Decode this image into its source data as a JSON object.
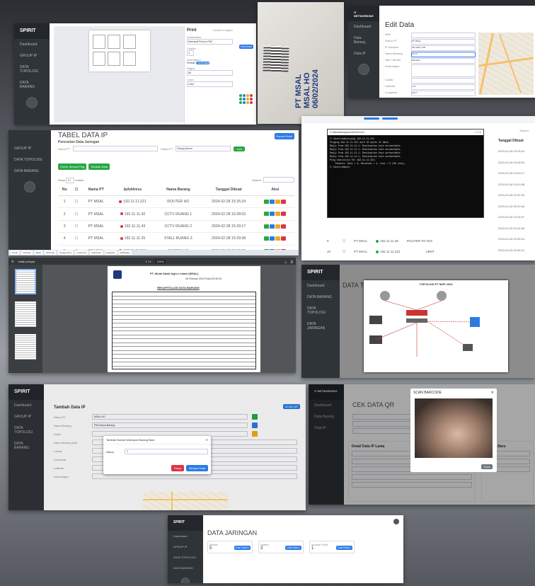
{
  "panel_print": {
    "title": "Print",
    "sheets": "1 sheet of paper",
    "destination_label": "Destination",
    "destination_value": "Microsoft Print to PDF",
    "copies_label": "Copies",
    "copies_value": "1",
    "layout_label": "Orientation",
    "options": [
      "Portrait",
      "Landscape"
    ],
    "pages_label": "Pages",
    "pages_value": "All",
    "color_label": "Color",
    "color_value": "Color",
    "sidebar_item": "Dashboard",
    "right_btn": "Download"
  },
  "panel_label": {
    "line1": "PT MSAL",
    "line2": "MSAL HO",
    "line3": "06/02/2024"
  },
  "panel_edit": {
    "brand": "IT NETWORKING",
    "title": "Edit Data",
    "labels": [
      "NPK",
      "Nama PT",
      "IP Address",
      "Nama Barang",
      "Tipe / Model",
      "Keterangan",
      "Lokasi",
      "Latitude",
      "Longitude"
    ],
    "values": [
      "",
      "PT MSAL",
      "192.168.1.100",
      "CCTV",
      "Hikvision",
      "",
      "",
      "-2.9",
      "104.7"
    ]
  },
  "panel_table": {
    "heading": "TABEL DATA IP",
    "subheading": "Pencarian Data Jaringan",
    "filter_label": "Nama PT",
    "filter2_label": "Status PT",
    "filter2_value": "Ruang Server",
    "btn_cari": "Cari",
    "btn_export": "Export Excel",
    "btn_check": "Check Semua Ping",
    "btn_add": "Tambah Data",
    "show_label": "Show",
    "show_value": "10",
    "entries_label": "entries",
    "search_label": "Search:",
    "sidebar": [
      "GROUP IP",
      "DATA TOPOLOGI",
      "DATA BARANG"
    ],
    "headers": [
      "No",
      "Nama PT",
      "IpAddress",
      "Nama Barang",
      "Tanggal Dibuat",
      "Aksi"
    ],
    "rows": [
      {
        "no": "1",
        "pt": "PT MSAL",
        "ip": "192.11.11.221",
        "barang": "ROUTER HO",
        "tgl": "2024-02-28 15:25:24"
      },
      {
        "no": "2",
        "pt": "PT MSAL",
        "ip": "192.11.11.42",
        "barang": "CCTV RUANG 1",
        "tgl": "2024-02-28 15:28:03"
      },
      {
        "no": "3",
        "pt": "PT MSAL",
        "ip": "192.11.11.43",
        "barang": "CCTV RUANG 2",
        "tgl": "2024-02-28 15:29:17"
      },
      {
        "no": "4",
        "pt": "PT MSAL",
        "ip": "192.11.11.25",
        "barang": "STALL RUANG 3",
        "tgl": "2024-02-28 15:29:38"
      },
      {
        "no": "5",
        "pt": "PT MSAL",
        "ip": "192.11.11.250",
        "barang": "SWITCH HO",
        "tgl": "2024-02-28 15:32:25"
      },
      {
        "no": "6",
        "pt": "PT MSAL",
        "ip": "192.11.11.5",
        "barang": "ACCESS POINT",
        "tgl": "2024-02-28 15:33:40"
      }
    ],
    "taskbar": [
      "Gmail",
      "YouTube",
      "Maps",
      "Personal",
      "Google Docs",
      "Local Host",
      "Facebook",
      "Instagram",
      "WhatsApp"
    ]
  },
  "panel_terminal": {
    "title": "C:\\Windows\\system32\\cmd.exe",
    "lines": [
      "C:\\Users\\Admin>ping 192.11.11.221",
      "",
      "Pinging 192.11.11.221 with 32 bytes of data:",
      "Reply from 192.11.11.1: Destination host unreachable.",
      "Reply from 192.11.11.1: Destination host unreachable.",
      "Reply from 192.11.11.1: Destination host unreachable.",
      "Reply from 192.11.11.1: Destination host unreachable.",
      "",
      "Ping statistics for 192.11.11.221:",
      "    Packets: Sent = 4, Received = 4, Lost = 0 (0% loss),",
      "",
      "C:\\Users\\Admin>"
    ],
    "search_label": "Search:",
    "col_header": "Tanggal Dibuat",
    "dates": [
      "2024-02-28 15:25:24",
      "2024-02-28 15:28:03",
      "2024-02-28 15:29:17",
      "2024-02-28 15:29:38",
      "2024-02-28 15:32:25",
      "2024-02-28 15:33:40",
      "2024-02-28 15:34:07",
      "2024-02-28 15:34:56",
      "2024-02-28 15:35:44",
      "2024-02-28 15:36:21"
    ],
    "row_a": {
      "no": "9",
      "pt": "PT MSAL",
      "ip": "192.11.11.36",
      "barang": "ROUTER TO TES"
    },
    "row_b": {
      "no": "10",
      "pt": "PT MSAL",
      "ip": "192.11.11.222",
      "barang": "UBNT"
    }
  },
  "panel_pdf": {
    "file": "cetak pdf.php",
    "page_info": "1 / 4",
    "zoom": "100%",
    "company": "PT. Mulia Sawit Agro Lestari (MSAL)",
    "date": "28 Februari 2024 Pukul 09:26:39",
    "report_title": "REKAPITULASI DATA BARANG"
  },
  "panel_topology": {
    "brand": "SPIRIT",
    "heading": "DATA TOPO",
    "diagram_title": "TOPOLOGI PT MSP 2024",
    "sidebar": [
      "Dashboard",
      "DATA BARANG",
      "DATA TOPOLOGI",
      "DATA JARINGAN"
    ]
  },
  "panel_form": {
    "brand": "SPIRIT",
    "title": "Tambah Data IP",
    "labels": [
      "Nama PT",
      "Nama Barang",
      "Divisi",
      "Nama Barang (Alt)",
      "Lokasi",
      "Koordinat",
      "Latitude",
      "Keterangan"
    ],
    "select_pt": "MSAL HO",
    "select_barang": "Pilih Nama Barang",
    "btn_scan": "SCAN QR",
    "modal_title": "Tambah Nama Kelompok Barang Baru",
    "modal_label": "Nama",
    "modal_value": "1",
    "btn_tutup": "Tutup",
    "btn_simpan": "Simpan Data",
    "sidebar": [
      "Dashboard",
      "GROUP IP",
      "DATA TOPOLOGI",
      "DATA BARANG"
    ]
  },
  "panel_qr": {
    "brand": "IT NETWORKING",
    "heading": "CEK DATA QR",
    "modal_title": "SCAN BARCODE",
    "btn_close": "Close",
    "section1": "Detail Data IP Lama",
    "section2": "Data IP Baru",
    "sidebar": [
      "Dashboard",
      "Data Barang",
      "Data IP"
    ]
  },
  "panel_jaringan": {
    "brand": "SPIRIT",
    "heading": "DATA JARINGAN",
    "sidebar": [
      "Dashboard",
      "GROUP IP",
      "DATA TOPOLOGI",
      "DATA BARANG"
    ],
    "cards": [
      {
        "label": "Router",
        "value": "5",
        "btn": "Chart Detail ▾"
      },
      {
        "label": "Switch",
        "value": "3",
        "btn": "Chart Detail ▾"
      },
      {
        "label": "Access Point",
        "value": "1",
        "btn": "Chart Detail ▾"
      }
    ]
  }
}
